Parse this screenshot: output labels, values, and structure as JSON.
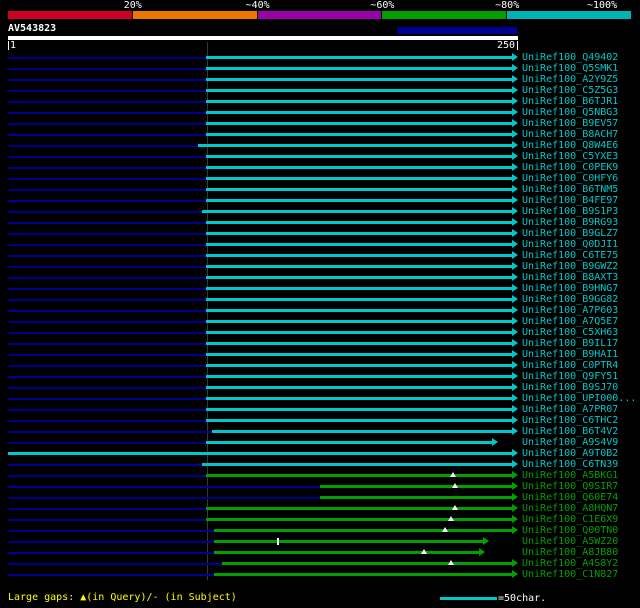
{
  "scale": {
    "labels": [
      "20%",
      "~40%",
      "~60%",
      "~80%",
      "~100%"
    ],
    "segment_colors": [
      "#cc0022",
      "#ee7700",
      "#9900aa",
      "#00a000",
      "#00b4b4"
    ]
  },
  "query": {
    "name": "AV543823"
  },
  "ruler": {
    "start": "1",
    "end": "250"
  },
  "footer": {
    "gaps_legend": "Large gaps: ▲(in Query)/- (in Subject)",
    "scale_value": "=50char."
  },
  "colors": {
    "cyan": "#00c8c8",
    "green": "#00a000",
    "navy": "#000090",
    "query_bar": "#ffffff",
    "query_masked": "#000090",
    "marker": "#ffffff",
    "gridline": "#383838",
    "footer_text": "#ffff00",
    "scale_line": "#00c8c8"
  },
  "chart_data": {
    "type": "alignment-hit-map",
    "title": "Sequence similarity hit distribution for query AV543823",
    "x_range": [
      0,
      250
    ],
    "x_unit": "residues",
    "legend": "bar color = % similarity bucket (red <20%, orange ~40%, purple ~60%, green ~80%, cyan ~100%); ▲ = large gap in query, | = gap in subject; arrowhead = subject continues",
    "marker_key": {
      "gq": "large gap in Query (▲)",
      "gs": "gap in Subject (|)"
    },
    "hits": [
      {
        "id": "UniRef100_Q49402",
        "color": "cyan",
        "similarity": "~100%",
        "start": 97,
        "end": 250
      },
      {
        "id": "UniRef100_Q5SMK1",
        "color": "cyan",
        "similarity": "~100%",
        "start": 97,
        "end": 250
      },
      {
        "id": "UniRef100_A2Y9Z5",
        "color": "cyan",
        "similarity": "~100%",
        "start": 97,
        "end": 250
      },
      {
        "id": "UniRef100_C5Z5G3",
        "color": "cyan",
        "similarity": "~100%",
        "start": 97,
        "end": 250
      },
      {
        "id": "UniRef100_B6TJR1",
        "color": "cyan",
        "similarity": "~100%",
        "start": 97,
        "end": 250
      },
      {
        "id": "UniRef100_Q5NBG3",
        "color": "cyan",
        "similarity": "~100%",
        "start": 97,
        "end": 250
      },
      {
        "id": "UniRef100_B9EV57",
        "color": "cyan",
        "similarity": "~100%",
        "start": 97,
        "end": 250
      },
      {
        "id": "UniRef100_B8ACH7",
        "color": "cyan",
        "similarity": "~100%",
        "start": 97,
        "end": 250
      },
      {
        "id": "UniRef100_Q8W4E6",
        "color": "cyan",
        "similarity": "~100%",
        "start": 93,
        "end": 250
      },
      {
        "id": "UniRef100_C5YXE3",
        "color": "cyan",
        "similarity": "~100%",
        "start": 97,
        "end": 250
      },
      {
        "id": "UniRef100_C0PEK9",
        "color": "cyan",
        "similarity": "~100%",
        "start": 97,
        "end": 250
      },
      {
        "id": "UniRef100_C0HFY6",
        "color": "cyan",
        "similarity": "~100%",
        "start": 97,
        "end": 250
      },
      {
        "id": "UniRef100_B6TNM5",
        "color": "cyan",
        "similarity": "~100%",
        "start": 97,
        "end": 250
      },
      {
        "id": "UniRef100_B4FE97",
        "color": "cyan",
        "similarity": "~100%",
        "start": 97,
        "end": 250
      },
      {
        "id": "UniRef100_B9S1P3",
        "color": "cyan",
        "similarity": "~100%",
        "start": 95,
        "end": 250
      },
      {
        "id": "UniRef100_B9RG93",
        "color": "cyan",
        "similarity": "~100%",
        "start": 97,
        "end": 250
      },
      {
        "id": "UniRef100_B9GLZ7",
        "color": "cyan",
        "similarity": "~100%",
        "start": 97,
        "end": 250
      },
      {
        "id": "UniRef100_Q0DJI1",
        "color": "cyan",
        "similarity": "~100%",
        "start": 97,
        "end": 250
      },
      {
        "id": "UniRef100_C6TE75",
        "color": "cyan",
        "similarity": "~100%",
        "start": 97,
        "end": 250
      },
      {
        "id": "UniRef100_B9GWZ2",
        "color": "cyan",
        "similarity": "~100%",
        "start": 97,
        "end": 250
      },
      {
        "id": "UniRef100_B8AXT3",
        "color": "cyan",
        "similarity": "~100%",
        "start": 97,
        "end": 250
      },
      {
        "id": "UniRef100_B9HNG7",
        "color": "cyan",
        "similarity": "~100%",
        "start": 97,
        "end": 250
      },
      {
        "id": "UniRef100_B9GG82",
        "color": "cyan",
        "similarity": "~100%",
        "start": 97,
        "end": 250
      },
      {
        "id": "UniRef100_A7P603",
        "color": "cyan",
        "similarity": "~100%",
        "start": 97,
        "end": 250
      },
      {
        "id": "UniRef100_A7Q5E7",
        "color": "cyan",
        "similarity": "~100%",
        "start": 97,
        "end": 250
      },
      {
        "id": "UniRef100_C5XH63",
        "color": "cyan",
        "similarity": "~100%",
        "start": 97,
        "end": 250
      },
      {
        "id": "UniRef100_B9IL17",
        "color": "cyan",
        "similarity": "~100%",
        "start": 97,
        "end": 250
      },
      {
        "id": "UniRef100_B9HAI1",
        "color": "cyan",
        "similarity": "~100%",
        "start": 97,
        "end": 250
      },
      {
        "id": "UniRef100_C0PTR4",
        "color": "cyan",
        "similarity": "~100%",
        "start": 97,
        "end": 250
      },
      {
        "id": "UniRef100_Q9FY51",
        "color": "cyan",
        "similarity": "~100%",
        "start": 97,
        "end": 250
      },
      {
        "id": "UniRef100_B9SJ70",
        "color": "cyan",
        "similarity": "~100%",
        "start": 97,
        "end": 250
      },
      {
        "id": "UniRef100_UPI000...",
        "color": "cyan",
        "similarity": "~100%",
        "start": 97,
        "end": 250
      },
      {
        "id": "UniRef100_A7PR07",
        "color": "cyan",
        "similarity": "~100%",
        "start": 97,
        "end": 250
      },
      {
        "id": "UniRef100_C6THC2",
        "color": "cyan",
        "similarity": "~100%",
        "start": 97,
        "end": 250
      },
      {
        "id": "UniRef100_B6T4V2",
        "color": "cyan",
        "similarity": "~100%",
        "start": 100,
        "end": 250
      },
      {
        "id": "UniRef100_A9S4V9",
        "color": "cyan",
        "similarity": "~100%",
        "start": 97,
        "end": 240
      },
      {
        "id": "UniRef100_A9T0B2",
        "color": "cyan",
        "similarity": "~100%",
        "start": 0,
        "end": 250
      },
      {
        "id": "UniRef100_C6TN39",
        "color": "cyan",
        "similarity": "~100%",
        "start": 95,
        "end": 250
      },
      {
        "id": "UniRef100_A5BKG1",
        "color": "green",
        "similarity": "~80%",
        "start": 97,
        "end": 250,
        "gq": [
          218
        ]
      },
      {
        "id": "UniRef100_Q9SIR7",
        "color": "green",
        "similarity": "~80%",
        "start": 153,
        "end": 250,
        "gq": [
          219
        ]
      },
      {
        "id": "UniRef100_Q60E74",
        "color": "green",
        "similarity": "~80%",
        "start": 153,
        "end": 250
      },
      {
        "id": "UniRef100_A8HQN7",
        "color": "green",
        "similarity": "~80%",
        "start": 97,
        "end": 250,
        "gq": [
          219
        ]
      },
      {
        "id": "UniRef100_C1E6X9",
        "color": "green",
        "similarity": "~80%",
        "start": 97,
        "end": 250,
        "gq": [
          217
        ]
      },
      {
        "id": "UniRef100_Q00TN0",
        "color": "green",
        "similarity": "~80%",
        "start": 101,
        "end": 250,
        "gq": [
          214
        ]
      },
      {
        "id": "UniRef100_A5WZ20",
        "color": "green",
        "similarity": "~80%",
        "start": 101,
        "end": 236,
        "gs": [
          132
        ]
      },
      {
        "id": "UniRef100_A8JB80",
        "color": "green",
        "similarity": "~80%",
        "start": 101,
        "end": 234,
        "gq": [
          204
        ]
      },
      {
        "id": "UniRef100_A4S8Y2",
        "color": "green",
        "similarity": "~80%",
        "start": 105,
        "end": 250,
        "gq": [
          217
        ]
      },
      {
        "id": "UniRef100_C1N827",
        "color": "green",
        "similarity": "~80%",
        "start": 101,
        "end": 250
      }
    ]
  }
}
